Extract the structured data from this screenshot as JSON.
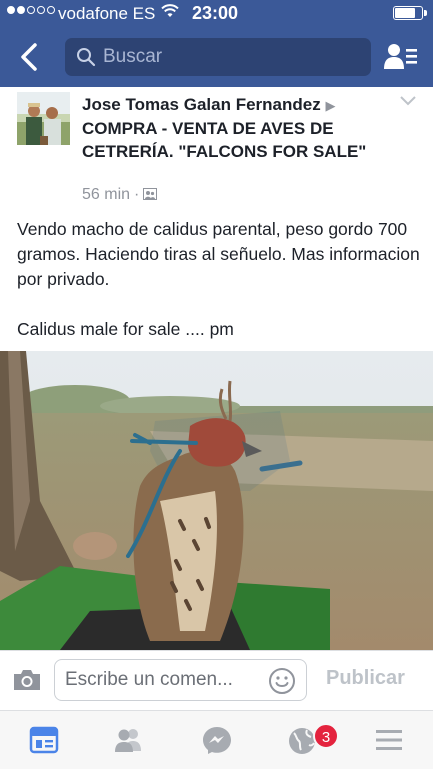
{
  "status_bar": {
    "carrier": "vodafone ES",
    "time": "23:00"
  },
  "nav": {
    "search_placeholder": "Buscar",
    "accent": "#3b5998"
  },
  "post": {
    "author": "Jose Tomas Galan Fernandez",
    "arrow": "▶",
    "group": "COMPRA - VENTA DE AVES DE CETRERÍA.   \"FALCONS FOR SALE\"",
    "time": "56 min",
    "separator": "·",
    "privacy_icon": "group-icon",
    "text": "Vendo macho de calidus parental, peso gordo 700 gramos. Haciendo tiras al señuelo. Mas informacion por privado.\n\nCalidus male for sale .... pm"
  },
  "comment": {
    "placeholder": "Escribe un comen...",
    "publish_label": "Publicar"
  },
  "tabbar": {
    "notifications_count": "3"
  }
}
